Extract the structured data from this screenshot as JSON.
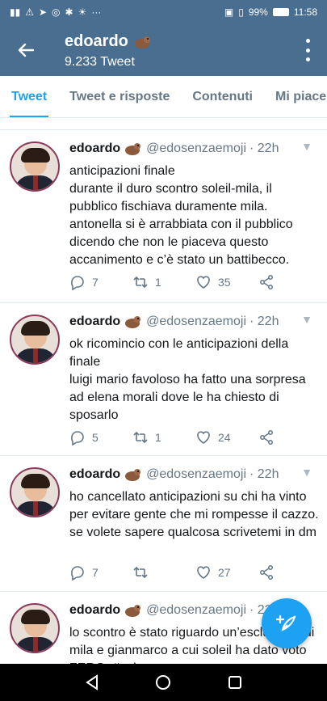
{
  "status_bar": {
    "left_icons": [
      "signal-icon",
      "warning-icon",
      "send-icon",
      "instagram-icon",
      "settings-icon",
      "brightness-icon",
      "more-dots-icon"
    ],
    "battery": "99%",
    "time": "11:58"
  },
  "app_bar": {
    "title": "edoardo",
    "subtitle": "9.233 Tweet"
  },
  "tabs": [
    {
      "label": "Tweet",
      "active": true
    },
    {
      "label": "Tweet e risposte",
      "active": false
    },
    {
      "label": "Contenuti",
      "active": false
    },
    {
      "label": "Mi piace",
      "active": false
    }
  ],
  "tweets": [
    {
      "name": "edoardo",
      "handle": "@edosenzaemoji",
      "time": "· 22h",
      "text": "anticipazioni finale\ndurante il duro scontro soleil-mila, il pubblico fischiava duramente mila. antonella si è arrabbiata con il pubblico dicendo che non le piaceva questo accanimento e c’è stato un battibecco.",
      "replies": "7",
      "retweets": "1",
      "likes": "35"
    },
    {
      "name": "edoardo",
      "handle": "@edosenzaemoji",
      "time": "· 22h",
      "text": "ok ricomincio con le anticipazioni della finale\nluigi mario favoloso ha fatto una sorpresa ad elena morali dove le ha chiesto di sposarlo",
      "replies": "5",
      "retweets": "1",
      "likes": "24"
    },
    {
      "name": "edoardo",
      "handle": "@edosenzaemoji",
      "time": "· 22h",
      "text": "ho cancellato anticipazioni su chi ha vinto per evitare gente che mi rompesse il cazzo. se volete sapere qualcosa scrivetemi in dm",
      "replies": "7",
      "retweets": "",
      "likes": "27"
    },
    {
      "name": "edoardo",
      "handle": "@edosenzaemoji",
      "time": "· 22h",
      "text": "lo scontro è stato riguardo un’esclusione di mila e gianmarco a cui soleil ha dato voto ZERO. #solearmy",
      "replies": "",
      "retweets": "",
      "likes": ""
    }
  ],
  "colors": {
    "header": "#4a6e8f",
    "accent": "#1da1f2",
    "secondary_text": "#657786"
  }
}
